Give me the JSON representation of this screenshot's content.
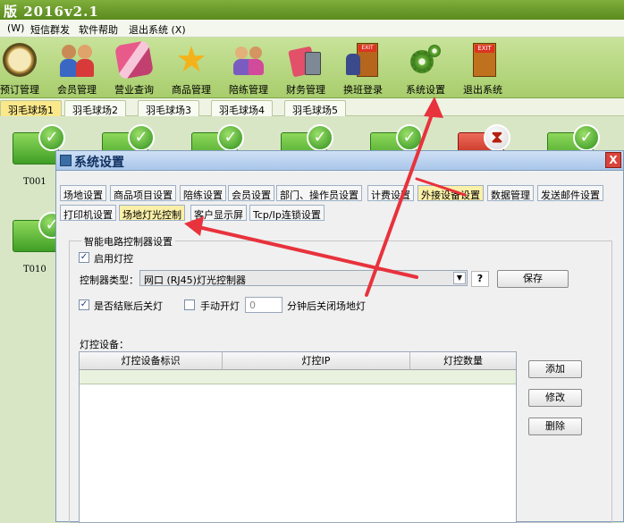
{
  "window": {
    "title": "版 2016v2.1"
  },
  "menu": [
    {
      "label": "(W)"
    },
    {
      "label": "短信群发"
    },
    {
      "label": "软件帮助"
    },
    {
      "label": "退出系统 (X)"
    }
  ],
  "toolbar": [
    {
      "label": "预订管理",
      "icon": "clock-icon"
    },
    {
      "label": "会员管理",
      "icon": "members-icon"
    },
    {
      "label": "营业查询",
      "icon": "query-icon"
    },
    {
      "label": "商品管理",
      "icon": "star-icon"
    },
    {
      "label": "陪练管理",
      "icon": "coach-icon"
    },
    {
      "label": "财务管理",
      "icon": "finance-icon"
    },
    {
      "label": "换班登录",
      "icon": "shift-icon"
    },
    {
      "label": "系统设置",
      "icon": "gear-icon"
    },
    {
      "label": "退出系统",
      "icon": "exit-icon"
    }
  ],
  "court_tabs": [
    {
      "label": "羽毛球场1"
    },
    {
      "label": "羽毛球场2"
    },
    {
      "label": "羽毛球场3"
    },
    {
      "label": "羽毛球场4"
    },
    {
      "label": "羽毛球场5"
    }
  ],
  "courts": [
    {
      "label": "T001"
    },
    {
      "label": "T010"
    }
  ],
  "dialog": {
    "title": "系统设置",
    "close": "X",
    "tabs_row1": [
      {
        "label": "场地设置"
      },
      {
        "label": "商品项目设置"
      },
      {
        "label": "陪练设置"
      },
      {
        "label": "会员设置"
      },
      {
        "label": "部门、操作员设置"
      },
      {
        "label": "计费设置"
      },
      {
        "label": "外接设备设置"
      },
      {
        "label": "数据管理"
      },
      {
        "label": "发送邮件设置"
      }
    ],
    "tabs_row2": [
      {
        "label": "打印机设置"
      },
      {
        "label": "场地灯光控制"
      },
      {
        "label": "客户显示屏"
      },
      {
        "label": "Tcp/Ip连锁设置"
      }
    ],
    "group_title": "智能电路控制器设置",
    "enable_light": {
      "label": "启用灯控",
      "checked": true
    },
    "controller_type_label": "控制器类型：",
    "controller_type_value": "网口 (RJ45)灯光控制器",
    "help_button": "?",
    "save_button": "保存",
    "auto_off": {
      "label": "是否结账后关灯",
      "checked": true
    },
    "manual_on": {
      "label": "手动开灯",
      "checked": false
    },
    "minutes_value": "0",
    "minutes_suffix": "分钟后关闭场地灯",
    "devices_label": "灯控设备：",
    "grid_columns": [
      {
        "label": "灯控设备标识"
      },
      {
        "label": "灯控IP"
      },
      {
        "label": "灯控数量"
      }
    ],
    "add_button": "添加",
    "edit_button": "修改",
    "delete_button": "删除"
  },
  "colors": {
    "accent_arrow": "#e8323c"
  }
}
